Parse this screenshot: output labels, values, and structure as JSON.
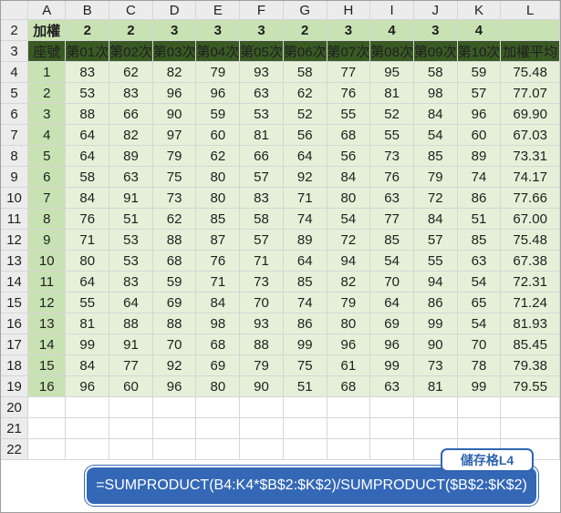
{
  "columns": [
    "A",
    "B",
    "C",
    "D",
    "E",
    "F",
    "G",
    "H",
    "I",
    "J",
    "K",
    "L"
  ],
  "row_numbers": [
    "2",
    "3",
    "4",
    "5",
    "6",
    "7",
    "8",
    "9",
    "10",
    "11",
    "12",
    "13",
    "14",
    "15",
    "16",
    "17",
    "18",
    "19",
    "20",
    "21",
    "22"
  ],
  "weight_row": {
    "label": "加權",
    "values": [
      "2",
      "2",
      "3",
      "3",
      "3",
      "2",
      "3",
      "4",
      "3",
      "4"
    ],
    "last": ""
  },
  "header_row": [
    "座號",
    "第01次",
    "第02次",
    "第03次",
    "第04次",
    "第05次",
    "第06次",
    "第07次",
    "第08次",
    "第09次",
    "第10次",
    "加權平均"
  ],
  "data_rows": [
    [
      "1",
      "83",
      "62",
      "82",
      "79",
      "93",
      "58",
      "77",
      "95",
      "58",
      "59",
      "75.48"
    ],
    [
      "2",
      "53",
      "83",
      "96",
      "96",
      "63",
      "62",
      "76",
      "81",
      "98",
      "57",
      "77.07"
    ],
    [
      "3",
      "88",
      "66",
      "90",
      "59",
      "53",
      "52",
      "55",
      "52",
      "84",
      "96",
      "69.90"
    ],
    [
      "4",
      "64",
      "82",
      "97",
      "60",
      "81",
      "56",
      "68",
      "55",
      "54",
      "60",
      "67.03"
    ],
    [
      "5",
      "64",
      "89",
      "79",
      "62",
      "66",
      "64",
      "56",
      "73",
      "85",
      "89",
      "73.31"
    ],
    [
      "6",
      "58",
      "63",
      "75",
      "80",
      "57",
      "92",
      "84",
      "76",
      "79",
      "74",
      "74.17"
    ],
    [
      "7",
      "84",
      "91",
      "73",
      "80",
      "83",
      "71",
      "80",
      "63",
      "72",
      "86",
      "77.66"
    ],
    [
      "8",
      "76",
      "51",
      "62",
      "85",
      "58",
      "74",
      "54",
      "77",
      "84",
      "51",
      "67.00"
    ],
    [
      "9",
      "71",
      "53",
      "88",
      "87",
      "57",
      "89",
      "72",
      "85",
      "57",
      "85",
      "75.48"
    ],
    [
      "10",
      "80",
      "53",
      "68",
      "76",
      "71",
      "64",
      "94",
      "54",
      "55",
      "63",
      "67.38"
    ],
    [
      "11",
      "64",
      "83",
      "59",
      "71",
      "73",
      "85",
      "82",
      "70",
      "94",
      "54",
      "72.31"
    ],
    [
      "12",
      "55",
      "64",
      "69",
      "84",
      "70",
      "74",
      "79",
      "64",
      "86",
      "65",
      "71.24"
    ],
    [
      "13",
      "81",
      "88",
      "88",
      "98",
      "93",
      "86",
      "80",
      "69",
      "99",
      "54",
      "81.93"
    ],
    [
      "14",
      "99",
      "91",
      "70",
      "68",
      "88",
      "99",
      "96",
      "96",
      "90",
      "70",
      "85.45"
    ],
    [
      "15",
      "84",
      "77",
      "92",
      "69",
      "79",
      "75",
      "61",
      "99",
      "73",
      "78",
      "79.38"
    ],
    [
      "16",
      "96",
      "60",
      "96",
      "80",
      "90",
      "51",
      "68",
      "63",
      "81",
      "99",
      "79.55"
    ]
  ],
  "callout": {
    "tag": "儲存格L4",
    "formula": "=SUMPRODUCT(B4:K4*$B$2:$K$2)/SUMPRODUCT($B$2:$K$2)"
  },
  "colors": {
    "dark_header": "#3a5a24",
    "weight_bg": "#c9e2b3",
    "data_bg": "#e4f1d8",
    "weight_text": "#1e3f7a",
    "callout_blue": "#3468b6"
  }
}
